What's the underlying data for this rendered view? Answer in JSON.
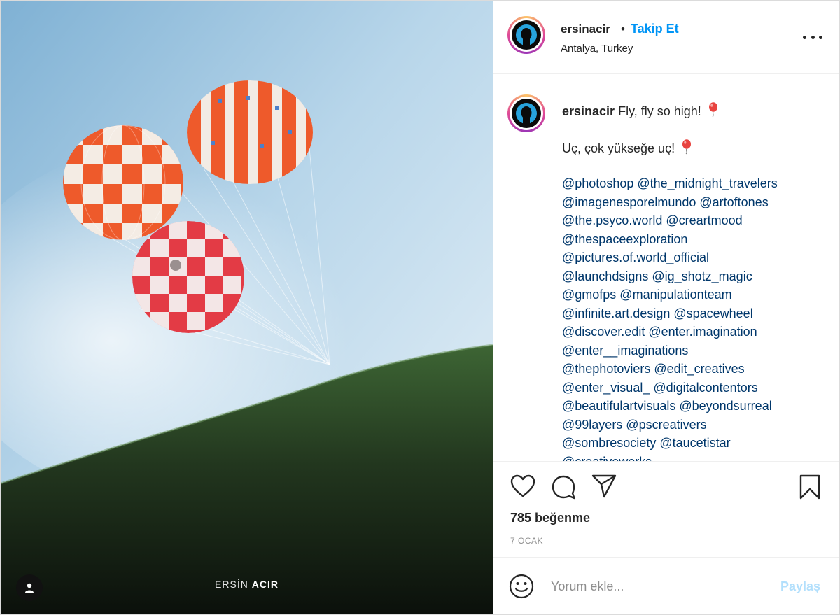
{
  "post": {
    "watermark_first": "ERSİN",
    "watermark_last": "ACIR"
  },
  "header": {
    "username": "ersinacir",
    "separator": "•",
    "follow_label": "Takip Et",
    "location": "Antalya, Turkey"
  },
  "caption": {
    "username": "ersinacir",
    "line_en": "Fly, fly so high!",
    "line_tr": "Uç, çok yükseğe uç!",
    "mention_lines": [
      "@photoshop @the_midnight_travelers",
      "@imagenesporelmundo @artoftones",
      "@the.psyco.world @creartmood",
      "@thespaceexploration",
      "@pictures.of.world_official",
      "@launchdsigns @ig_shotz_magic",
      "@gmofps @manipulationteam",
      "@infinite.art.design @spacewheel",
      "@discover.edit @enter.imagination",
      "@enter__imaginations",
      "@thephotoviers @edit_creatives",
      "@enter_visual_ @digitalcontentors",
      "@beautifulartvisuals @beyondsurreal",
      "@99layers @pscreativers",
      "@sombresociety @taucetistar",
      "@creativeworks"
    ]
  },
  "stats": {
    "likes": "785 beğenme",
    "date": "7 OCAK"
  },
  "comment": {
    "placeholder": "Yorum ekle...",
    "post_label": "Paylaş"
  },
  "icons": {
    "like": "heart-icon",
    "comment": "comment-bubble-icon",
    "share": "paper-plane-icon",
    "save": "bookmark-icon",
    "emoji": "smiley-icon",
    "more": "more-options-icon",
    "tag": "user-tag-icon",
    "balloon": "balloon-emoji"
  },
  "colors": {
    "link_blue": "#0095f6",
    "mention_blue": "#00376b",
    "post_button_disabled": "#b2dffc",
    "text": "#262626",
    "muted": "#8e8e8e"
  }
}
